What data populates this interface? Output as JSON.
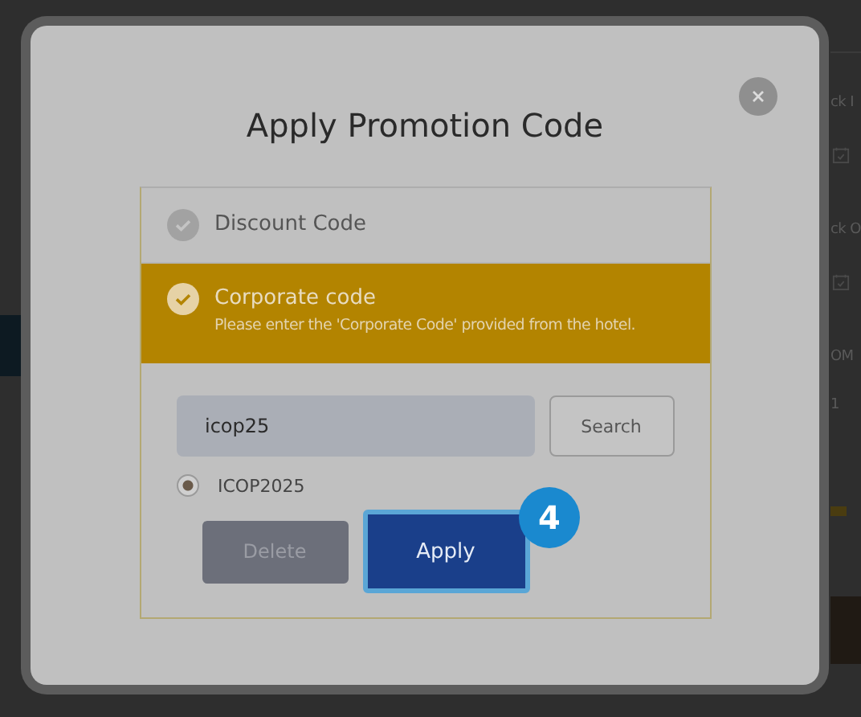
{
  "background_page": {
    "labels": [
      "ck I",
      "ck O",
      "OM",
      "1"
    ]
  },
  "dialog": {
    "title": "Apply Promotion Code",
    "options": [
      {
        "label": "Discount Code",
        "selected": false
      },
      {
        "label": "Corporate code",
        "description": "Please enter the 'Corporate Code' provided from the hotel.",
        "selected": true
      }
    ],
    "code_field": {
      "value": "icop25"
    },
    "search_button": "Search",
    "results": [
      {
        "label": "ICOP2025",
        "selected": true
      }
    ],
    "buttons": [
      {
        "label": "Delete",
        "kind": "secondary",
        "disabled": true
      },
      {
        "label": "Apply",
        "kind": "primary",
        "disabled": false
      }
    ],
    "step_badge": "4"
  }
}
